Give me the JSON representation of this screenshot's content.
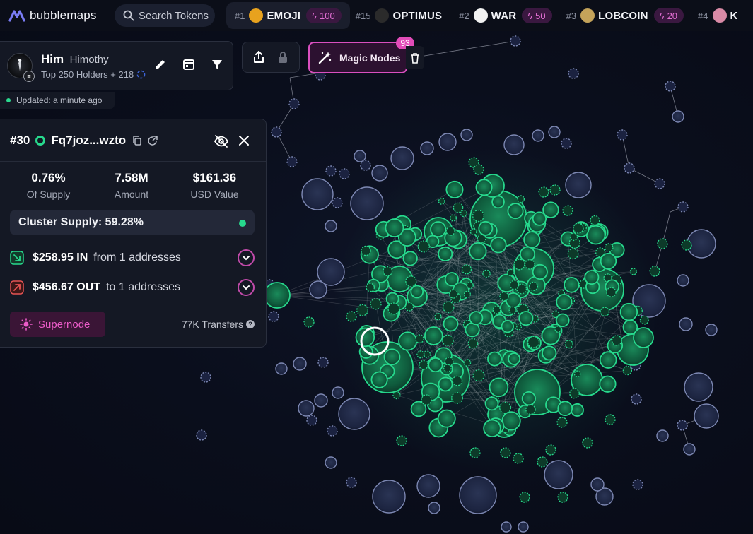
{
  "brand": {
    "name": "bubblemaps"
  },
  "search": {
    "label": "Search Tokens"
  },
  "ticker": [
    {
      "rank": "#1",
      "name": "EMOJI",
      "badge": "100",
      "active": true,
      "logo_color": "#e8a21e"
    },
    {
      "rank": "#15",
      "name": "OPTIMUS",
      "badge": "",
      "active": false,
      "logo_color": "#2b2b2b"
    },
    {
      "rank": "#2",
      "name": "WAR",
      "badge": "50",
      "active": false,
      "logo_color": "#f2f2f2"
    },
    {
      "rank": "#3",
      "name": "LOBCOIN",
      "badge": "20",
      "active": false,
      "logo_color": "#c4a35a"
    },
    {
      "rank": "#4",
      "name": "K",
      "badge": "",
      "active": false,
      "logo_color": "#d98aa6"
    }
  ],
  "profile": {
    "name": "Him",
    "handle": "Himothy",
    "subtitle": "Top 250 Holders + 218",
    "avatar_badge": "≡",
    "updated": "Updated: a minute ago"
  },
  "magic_nodes": {
    "label": "Magic Nodes",
    "count": "93"
  },
  "detail": {
    "rank": "#30",
    "address": "Fq7joz...wzto",
    "stats": [
      {
        "value": "0.76%",
        "label": "Of Supply"
      },
      {
        "value": "7.58M",
        "label": "Amount"
      },
      {
        "value": "$161.36",
        "label": "USD Value"
      }
    ],
    "cluster_supply": "Cluster Supply: 59.28%",
    "inflow": {
      "amount": "$258.95 IN",
      "desc": "from 1 addresses"
    },
    "outflow": {
      "amount": "$456.67 OUT",
      "desc": "to 1 addresses"
    },
    "supernode_label": "Supernode",
    "transfers": "77K Transfers"
  },
  "colors": {
    "accent_green": "#27d98d",
    "accent_magenta": "#d94fbf",
    "bubble_blue": "#26304d"
  },
  "icons": {
    "brand": "bubblemaps-logo-icon",
    "search": "search-icon",
    "edit": "pencil-icon",
    "calendar": "calendar-icon",
    "filter": "filter-icon",
    "share": "share-icon",
    "lock": "lock-icon",
    "magic": "magic-wand-icon",
    "trash": "trash-icon",
    "copy": "copy-icon",
    "external": "external-link-icon",
    "hide": "eye-off-icon",
    "close": "close-icon",
    "in": "arrow-in-icon",
    "out": "arrow-out-icon",
    "expand": "chevron-down-icon",
    "supernode": "sun-icon",
    "help": "question-icon"
  }
}
